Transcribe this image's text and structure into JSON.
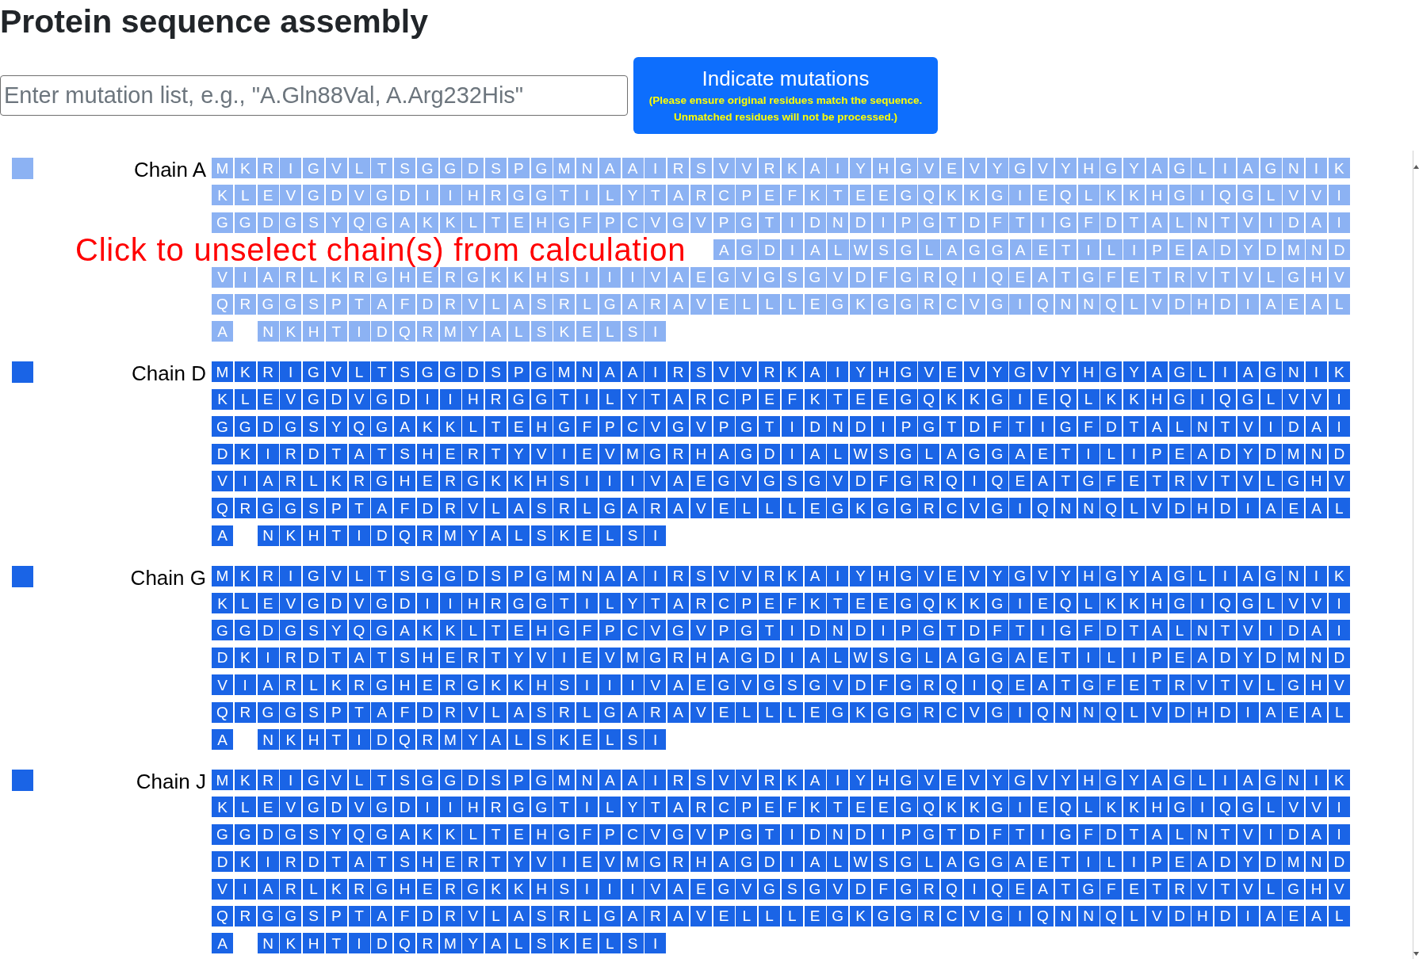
{
  "title": "Protein sequence assembly",
  "mutation_input": {
    "placeholder": "Enter mutation list, e.g., \"A.Gln88Val, A.Arg232His\""
  },
  "indicate_button": {
    "label": "Indicate mutations",
    "note": "(Please ensure original residues match the sequence. Unmatched residues will not be processed.)"
  },
  "chains": [
    {
      "label": "Chain A",
      "selected": false,
      "tooltip": {
        "text": "Click to unselect chain(s) from calculation"
      },
      "rows": [
        {
          "segments": [
            "M K R I G V L T S G G D S P G M N A A I R S V V R K A I Y H G V E V Y G V Y H G Y A G L I A G N I K"
          ],
          "covered": false
        },
        {
          "segments": [
            "K L E V G D V G D I I H R G G T I L Y T A R C P E F K T E E G Q K K G I E Q L K K H G I Q G L V V I"
          ],
          "covered": false
        },
        {
          "segments": [
            "G G D G S Y Q G A K K L T E H G F P C V G V P G T I D N D I P G T D F T I G F D T A L N T V I D A I"
          ],
          "covered": false
        },
        {
          "segments": [
            "A G D I A L W S G L A G G A E T I L I P E A D Y D M N D"
          ],
          "covered": true
        },
        {
          "segments": [
            "V I A R L K R G H E R G K K H S I I I V A E G V G S G V D F G R Q I Q E A T G F E T R V T V L G H V"
          ],
          "covered": false
        },
        {
          "segments": [
            "Q R G G S P T A F D R V L A S R L G A R A V E L L L E G K G G R C V G I Q N N Q L V D H D I A E A L"
          ],
          "covered": false
        },
        {
          "segments": [
            "A",
            "N K H T I D Q R M Y A L S K E L S I"
          ],
          "covered": false
        }
      ]
    },
    {
      "label": "Chain D",
      "selected": true,
      "rows": [
        {
          "segments": [
            "M K R I G V L T S G G D S P G M N A A I R S V V R K A I Y H G V E V Y G V Y H G Y A G L I A G N I K"
          ],
          "covered": false
        },
        {
          "segments": [
            "K L E V G D V G D I I H R G G T I L Y T A R C P E F K T E E G Q K K G I E Q L K K H G I Q G L V V I"
          ],
          "covered": false
        },
        {
          "segments": [
            "G G D G S Y Q G A K K L T E H G F P C V G V P G T I D N D I P G T D F T I G F D T A L N T V I D A I"
          ],
          "covered": false
        },
        {
          "segments": [
            "D K I R D T A T S H E R T Y V I E V M G R H A G D I A L W S G L A G G A E T I L I P E A D Y D M N D"
          ],
          "covered": false
        },
        {
          "segments": [
            "V I A R L K R G H E R G K K H S I I I V A E G V G S G V D F G R Q I Q E A T G F E T R V T V L G H V"
          ],
          "covered": false
        },
        {
          "segments": [
            "Q R G G S P T A F D R V L A S R L G A R A V E L L L E G K G G R C V G I Q N N Q L V D H D I A E A L"
          ],
          "covered": false
        },
        {
          "segments": [
            "A",
            "N K H T I D Q R M Y A L S K E L S I"
          ],
          "covered": false
        }
      ]
    },
    {
      "label": "Chain G",
      "selected": true,
      "rows": [
        {
          "segments": [
            "M K R I G V L T S G G D S P G M N A A I R S V V R K A I Y H G V E V Y G V Y H G Y A G L I A G N I K"
          ],
          "covered": false
        },
        {
          "segments": [
            "K L E V G D V G D I I H R G G T I L Y T A R C P E F K T E E G Q K K G I E Q L K K H G I Q G L V V I"
          ],
          "covered": false
        },
        {
          "segments": [
            "G G D G S Y Q G A K K L T E H G F P C V G V P G T I D N D I P G T D F T I G F D T A L N T V I D A I"
          ],
          "covered": false
        },
        {
          "segments": [
            "D K I R D T A T S H E R T Y V I E V M G R H A G D I A L W S G L A G G A E T I L I P E A D Y D M N D"
          ],
          "covered": false
        },
        {
          "segments": [
            "V I A R L K R G H E R G K K H S I I I V A E G V G S G V D F G R Q I Q E A T G F E T R V T V L G H V"
          ],
          "covered": false
        },
        {
          "segments": [
            "Q R G G S P T A F D R V L A S R L G A R A V E L L L E G K G G R C V G I Q N N Q L V D H D I A E A L"
          ],
          "covered": false
        },
        {
          "segments": [
            "A",
            "N K H T I D Q R M Y A L S K E L S I"
          ],
          "covered": false
        }
      ]
    },
    {
      "label": "Chain J",
      "selected": true,
      "rows": [
        {
          "segments": [
            "M K R I G V L T S G G D S P G M N A A I R S V V R K A I Y H G V E V Y G V Y H G Y A G L I A G N I K"
          ],
          "covered": false
        },
        {
          "segments": [
            "K L E V G D V G D I I H R G G T I L Y T A R C P E F K T E E G Q K K G I E Q L K K H G I Q G L V V I"
          ],
          "covered": false
        },
        {
          "segments": [
            "G G D G S Y Q G A K K L T E H G F P C V G V P G T I D N D I P G T D F T I G F D T A L N T V I D A I"
          ],
          "covered": false
        },
        {
          "segments": [
            "D K I R D T A T S H E R T Y V I E V M G R H A G D I A L W S G L A G G A E T I L I P E A D Y D M N D"
          ],
          "covered": false
        },
        {
          "segments": [
            "V I A R L K R G H E R G K K H S I I I V A E G V G S G V D F G R Q I Q E A T G F E T R V T V L G H V"
          ],
          "covered": false
        },
        {
          "segments": [
            "Q R G G S P T A F D R V L A S R L G A R A V E L L L E G K G G R C V G I Q N N Q L V D H D I A E A L"
          ],
          "covered": false
        },
        {
          "segments": [
            "A",
            "N K H T I D Q R M Y A L S K E L S I"
          ],
          "covered": false
        }
      ]
    }
  ]
}
